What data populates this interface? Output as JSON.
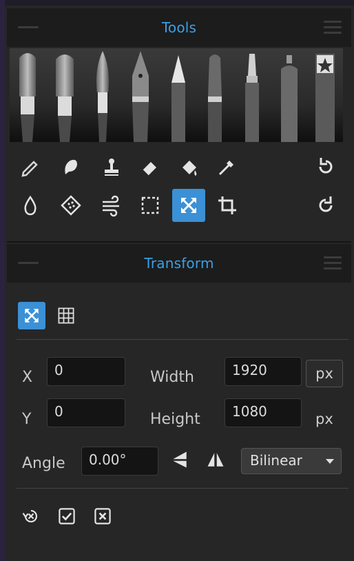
{
  "tools_panel": {
    "title": "Tools",
    "brushes": [
      "brush-round-icon",
      "brush-flat-icon",
      "brush-pointed-icon",
      "pen-nib-icon",
      "pencil-icon",
      "marker-icon",
      "felt-tip-icon",
      "spray-can-icon",
      "favorite-brush-icon"
    ],
    "row1": [
      "pencil-tool-icon",
      "smudge-tool-icon",
      "stamp-tool-icon",
      "eraser-tool-icon",
      "fill-bucket-icon",
      "eyedropper-icon",
      "undo-icon"
    ],
    "row2": [
      "water-drop-icon",
      "texture-patch-icon",
      "blend-wind-icon",
      "selection-icon",
      "transform-icon",
      "crop-icon",
      "redo-icon"
    ],
    "active_tool": "transform-icon"
  },
  "transform_panel": {
    "title": "Transform",
    "modes": [
      "free-transform-icon",
      "mesh-grid-icon"
    ],
    "x_label": "X",
    "x_value": "0",
    "y_label": "Y",
    "y_value": "0",
    "width_label": "Width",
    "width_value": "1920",
    "height_label": "Height",
    "height_value": "1080",
    "unit": "px",
    "angle_label": "Angle",
    "angle_value": "0.00°",
    "interpolation": "Bilinear"
  },
  "colors": {
    "accent": "#3aa0e6",
    "active_bg": "#3b90d6",
    "panel_bg": "#262626",
    "header_bg": "#1c1c1c"
  }
}
